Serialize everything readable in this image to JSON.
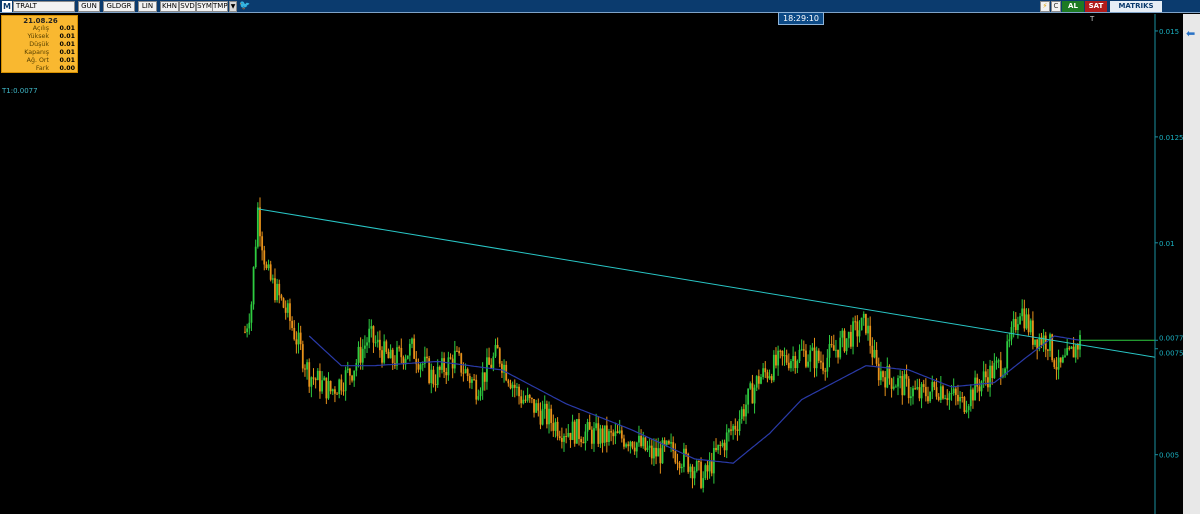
{
  "toolbar": {
    "logo": "M",
    "symbol": "TRALT",
    "period": "GUN",
    "buttons": [
      "GLDGR",
      "LIN",
      "KHN",
      "SVD",
      "SYM",
      "TMP"
    ],
    "al": "AL",
    "sat": "SAT",
    "brand": "MATRIKS",
    "icons": [
      "flash-icon",
      "document-icon",
      "refresh-icon"
    ]
  },
  "clock": "18:29:10",
  "info_panel": {
    "date": "21.08.26",
    "rows": [
      {
        "label": "Açılış",
        "value": "0.01"
      },
      {
        "label": "Yüksek",
        "value": "0.01"
      },
      {
        "label": "Düşük",
        "value": "0.01"
      },
      {
        "label": "Kapanış",
        "value": "0.01"
      },
      {
        "label": "Ağ. Ort",
        "value": "0.01"
      },
      {
        "label": "Fark",
        "value": "0.00"
      }
    ]
  },
  "indicator_label": "T1:0.0077",
  "corner_mark": "T",
  "colors": {
    "background": "#000000",
    "up_candle": "#2ecc40",
    "down_candle": "#e8921a",
    "moving_average": "#2a3aa8",
    "trendline": "#29c6c6",
    "axis_text": "#1ab0c0",
    "info_panel": "#f9b830"
  },
  "chart_data": {
    "type": "candlestick",
    "y_axis": {
      "position": "right",
      "ticks": [
        "0.015",
        "0.0125",
        "0.01",
        "0.0077",
        "0.0075",
        "0.005"
      ],
      "range": [
        0.0036,
        0.0154
      ]
    },
    "price_waypoints": [
      [
        0,
        0.0079
      ],
      [
        3,
        0.0086
      ],
      [
        6,
        0.0108
      ],
      [
        10,
        0.0093
      ],
      [
        20,
        0.0083
      ],
      [
        30,
        0.0069
      ],
      [
        40,
        0.0065
      ],
      [
        50,
        0.007
      ],
      [
        58,
        0.0078
      ],
      [
        68,
        0.0072
      ],
      [
        78,
        0.0075
      ],
      [
        88,
        0.0068
      ],
      [
        98,
        0.0073
      ],
      [
        108,
        0.0066
      ],
      [
        118,
        0.0074
      ],
      [
        128,
        0.0064
      ],
      [
        138,
        0.006
      ],
      [
        148,
        0.0056
      ],
      [
        160,
        0.0055
      ],
      [
        170,
        0.0054
      ],
      [
        180,
        0.0054
      ],
      [
        190,
        0.005
      ],
      [
        200,
        0.0051
      ],
      [
        210,
        0.0047
      ],
      [
        214,
        0.0044
      ],
      [
        220,
        0.005
      ],
      [
        230,
        0.0058
      ],
      [
        240,
        0.0068
      ],
      [
        250,
        0.0072
      ],
      [
        260,
        0.0074
      ],
      [
        270,
        0.0072
      ],
      [
        280,
        0.0077
      ],
      [
        290,
        0.0081
      ],
      [
        295,
        0.007
      ],
      [
        305,
        0.0067
      ],
      [
        315,
        0.0064
      ],
      [
        325,
        0.0066
      ],
      [
        335,
        0.0062
      ],
      [
        345,
        0.0068
      ],
      [
        355,
        0.0072
      ],
      [
        362,
        0.0085
      ],
      [
        368,
        0.0078
      ],
      [
        375,
        0.0077
      ],
      [
        380,
        0.007
      ],
      [
        385,
        0.0073
      ],
      [
        390,
        0.0077
      ]
    ],
    "candle_count": 391,
    "moving_average": {
      "start_index": 30,
      "waypoints": [
        [
          30,
          0.0078
        ],
        [
          45,
          0.0071
        ],
        [
          60,
          0.0071
        ],
        [
          90,
          0.0072
        ],
        [
          120,
          0.007
        ],
        [
          150,
          0.0062
        ],
        [
          180,
          0.0056
        ],
        [
          210,
          0.0049
        ],
        [
          228,
          0.0048
        ],
        [
          245,
          0.0055
        ],
        [
          260,
          0.0063
        ],
        [
          275,
          0.0067
        ],
        [
          290,
          0.0071
        ],
        [
          310,
          0.007
        ],
        [
          330,
          0.0066
        ],
        [
          350,
          0.0067
        ],
        [
          365,
          0.0073
        ],
        [
          378,
          0.0078
        ],
        [
          390,
          0.0077
        ]
      ]
    },
    "trendline": {
      "start": [
        6,
        0.0108
      ],
      "end_value_at_axis": 0.0073
    },
    "last_price_line": 0.0077
  }
}
